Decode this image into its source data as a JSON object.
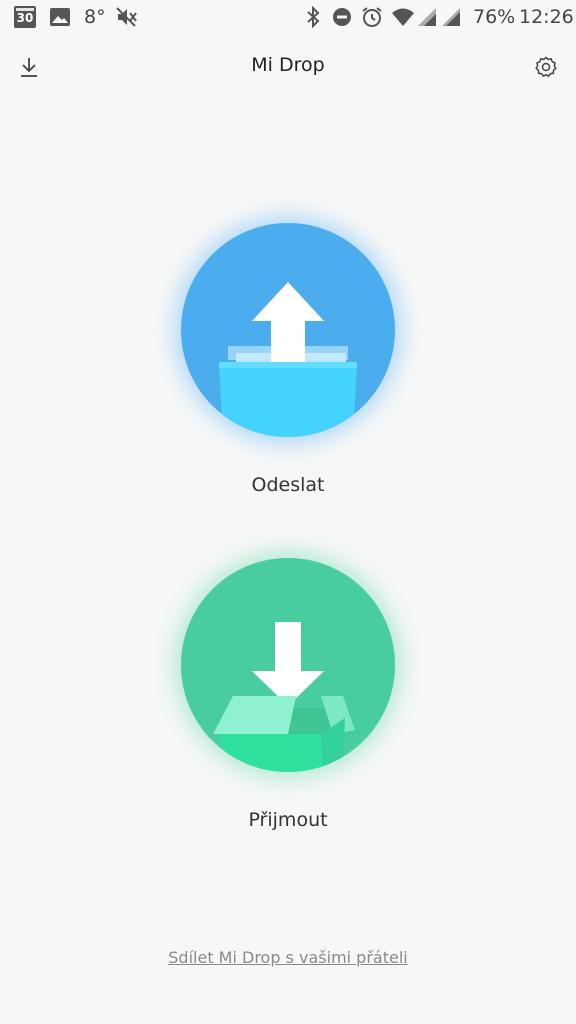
{
  "status_bar": {
    "calendar_day": "30",
    "temperature": "8°",
    "battery": "76%",
    "time": "12:26",
    "icons": [
      "calendar-icon",
      "gallery-icon",
      "mute-icon",
      "bluetooth-icon",
      "do-not-disturb-icon",
      "alarm-icon",
      "wifi-icon",
      "signal-icon",
      "signal-icon"
    ]
  },
  "app_bar": {
    "title": "Mi Drop",
    "left_icon": "download-icon",
    "right_icon": "settings-icon"
  },
  "actions": {
    "send_label": "Odeslat",
    "send_icon": "upload-folder-icon",
    "send_color": "#4badee",
    "receive_label": "Přijmout",
    "receive_icon": "download-box-icon",
    "receive_color": "#48cca0"
  },
  "footer": {
    "share_link": "Sdílet Mi Drop s vašimi přáteli"
  }
}
